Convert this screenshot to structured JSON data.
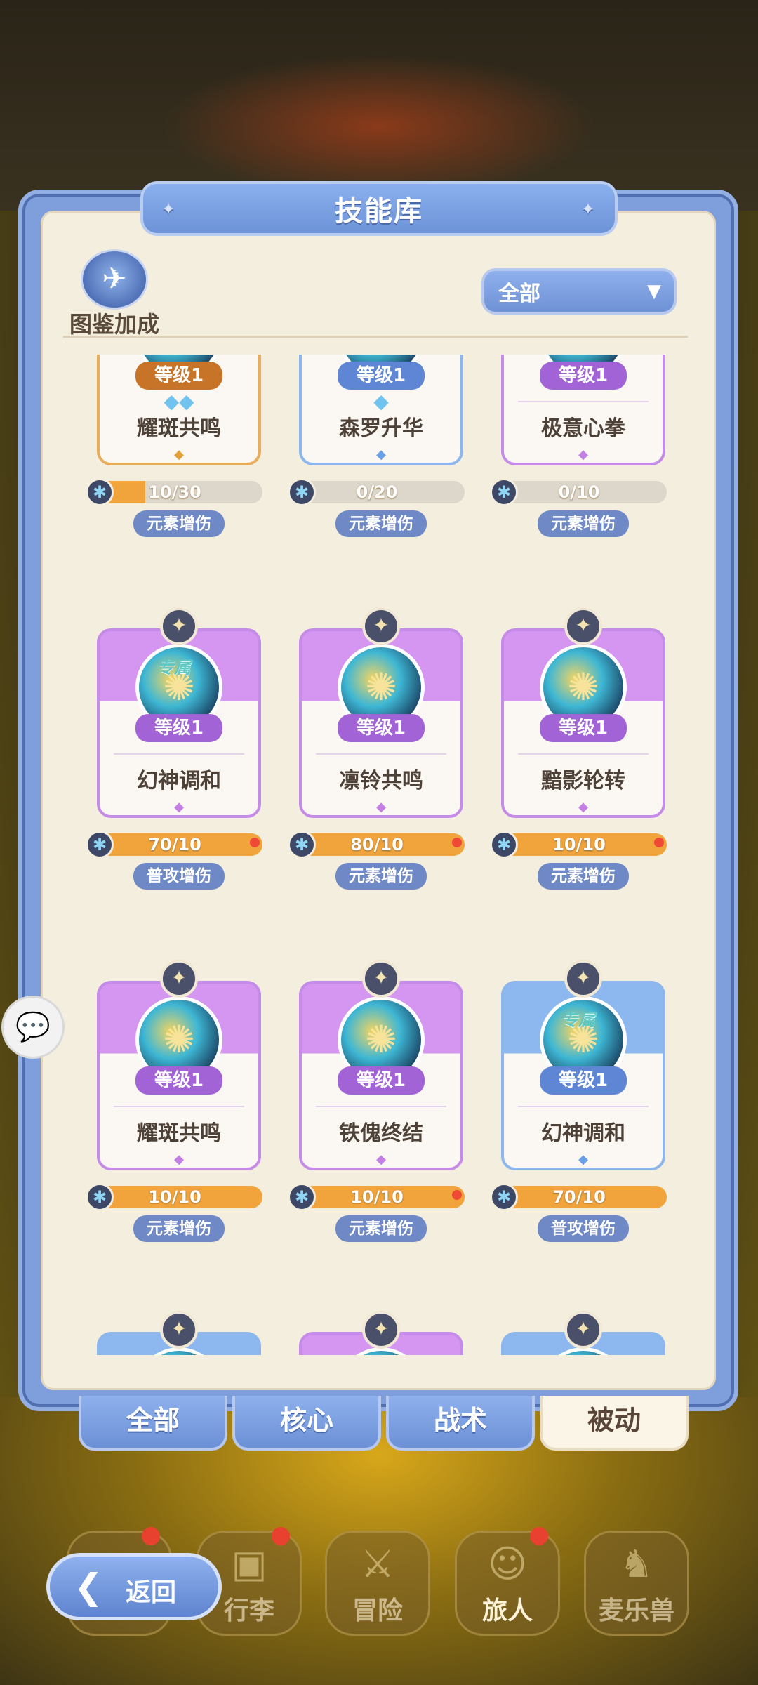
{
  "title": "技能库",
  "codex": {
    "label": "图鉴加成",
    "icon": "codex-bonus-icon"
  },
  "filter": {
    "selected": "全部",
    "icon": "dropdown-arrow-icon"
  },
  "cards": [
    {
      "name": "耀斑共鸣",
      "level": "等级1",
      "rarity": "orange",
      "progress_text": "10/30",
      "progress": 0.33,
      "tag": "元素增伤",
      "badge": false,
      "exclusive": "",
      "diamonds": "◆◆",
      "dot": false
    },
    {
      "name": "森罗升华",
      "level": "等级1",
      "rarity": "blue",
      "progress_text": "0/20",
      "progress": 0,
      "tag": "元素增伤",
      "badge": false,
      "exclusive": "",
      "diamonds": "◆",
      "dot": false
    },
    {
      "name": "极意心拳",
      "level": "等级1",
      "rarity": "purple",
      "progress_text": "0/10",
      "progress": 0,
      "tag": "元素增伤",
      "badge": false,
      "exclusive": "",
      "diamonds": "",
      "dot": false
    },
    {
      "name": "幻神调和",
      "level": "等级1",
      "rarity": "purple",
      "progress_text": "70/10",
      "progress": 1,
      "tag": "普攻增伤",
      "badge": true,
      "exclusive": "专属",
      "diamonds": "",
      "dot": true
    },
    {
      "name": "凛铃共鸣",
      "level": "等级1",
      "rarity": "purple",
      "progress_text": "80/10",
      "progress": 1,
      "tag": "元素增伤",
      "badge": true,
      "exclusive": "",
      "diamonds": "",
      "dot": true
    },
    {
      "name": "黯影轮转",
      "level": "等级1",
      "rarity": "purple",
      "progress_text": "10/10",
      "progress": 1,
      "tag": "元素增伤",
      "badge": true,
      "exclusive": "",
      "diamonds": "",
      "dot": true
    },
    {
      "name": "耀斑共鸣",
      "level": "等级1",
      "rarity": "purple",
      "progress_text": "10/10",
      "progress": 1,
      "tag": "元素增伤",
      "badge": true,
      "exclusive": "",
      "diamonds": "",
      "dot": false
    },
    {
      "name": "铁傀终结",
      "level": "等级1",
      "rarity": "purple",
      "progress_text": "10/10",
      "progress": 1,
      "tag": "元素增伤",
      "badge": true,
      "exclusive": "",
      "diamonds": "",
      "dot": true
    },
    {
      "name": "幻神调和",
      "level": "等级1",
      "rarity": "blue",
      "progress_text": "70/10",
      "progress": 1,
      "tag": "普攻增伤",
      "badge": true,
      "exclusive": "专属",
      "diamonds": "",
      "dot": false
    },
    {
      "name": "",
      "level": "",
      "rarity": "blue",
      "progress_text": "",
      "progress": 0,
      "tag": "",
      "badge": true,
      "exclusive": "",
      "diamonds": "",
      "dot": false
    },
    {
      "name": "",
      "level": "",
      "rarity": "purple",
      "progress_text": "",
      "progress": 0,
      "tag": "",
      "badge": true,
      "exclusive": "",
      "diamonds": "",
      "dot": false
    },
    {
      "name": "",
      "level": "",
      "rarity": "blue",
      "progress_text": "",
      "progress": 0,
      "tag": "",
      "badge": true,
      "exclusive": "",
      "diamonds": "",
      "dot": false
    }
  ],
  "tabs": [
    {
      "label": "全部",
      "active": false
    },
    {
      "label": "核心",
      "active": false
    },
    {
      "label": "战术",
      "active": false
    },
    {
      "label": "被动",
      "active": true
    }
  ],
  "back": {
    "label": "返回",
    "icon": "back-arrow-icon"
  },
  "nav": [
    {
      "label": "",
      "icon": "home-icon",
      "dot": true,
      "active": false
    },
    {
      "label": "行李",
      "icon": "chest-icon",
      "dot": true,
      "active": false
    },
    {
      "label": "冒险",
      "icon": "crossed-swords-icon",
      "dot": false,
      "active": false
    },
    {
      "label": "旅人",
      "icon": "traveler-icon",
      "dot": true,
      "active": true
    },
    {
      "label": "麦乐兽",
      "icon": "pet-icon",
      "dot": false,
      "active": false
    }
  ],
  "colors": {
    "accent": "#7f9fdc",
    "panel": "#f4eedf",
    "progress": "#f2a43c",
    "alert": "#ee4a35"
  }
}
